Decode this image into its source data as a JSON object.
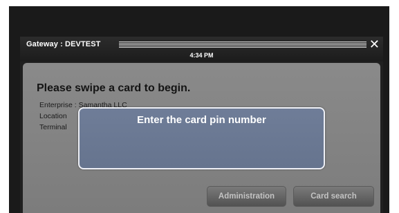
{
  "window": {
    "title": "Gateway : DEVTEST",
    "time": "4:34 PM",
    "close_icon": "close-icon"
  },
  "main": {
    "prompt": "Please swipe a card to begin.",
    "info": {
      "enterprise": "Enterprise : Samantha LLC",
      "location": "Location",
      "terminal": "Terminal"
    },
    "buttons": {
      "administration": "Administration",
      "card_search": "Card search"
    }
  },
  "modal": {
    "title": "Enter the card pin number"
  },
  "colors": {
    "modal_bg": "#6f7d98",
    "panel_bg": "#8a8a8a",
    "titlebar_bg": "#202020"
  }
}
